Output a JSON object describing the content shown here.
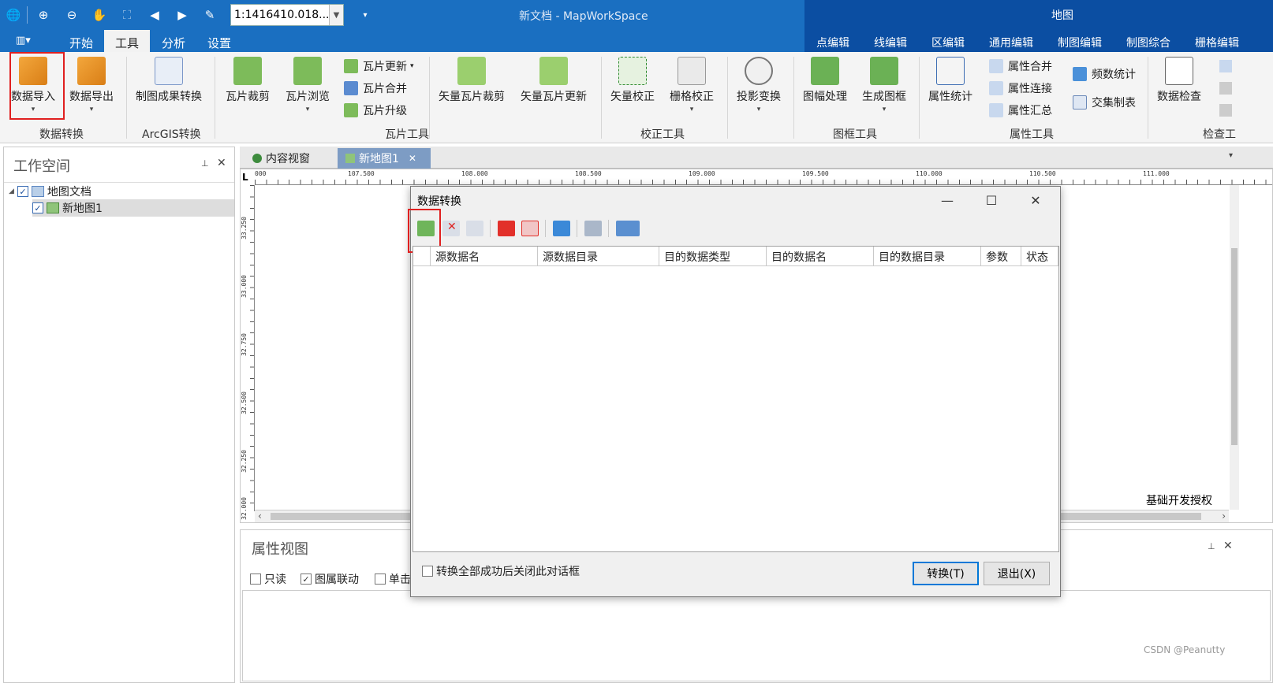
{
  "titlebar": {
    "scale_value": "1:1416410.018...",
    "doc_title": "新文档 - MapWorkSpace",
    "map_context_title": "地图"
  },
  "menu_tabs": [
    "开始",
    "工具",
    "分析",
    "设置"
  ],
  "menu_active": "工具",
  "context_tabs": [
    "点编辑",
    "线编辑",
    "区编辑",
    "通用编辑",
    "制图编辑",
    "制图综合",
    "栅格编辑"
  ],
  "ribbon": {
    "data_import": "数据导入",
    "data_export": "数据导出",
    "map_result_convert": "制图成果转换",
    "tile_clip": "瓦片裁剪",
    "tile_browse": "瓦片浏览",
    "tile_update": "瓦片更新",
    "tile_merge": "瓦片合并",
    "tile_upgrade": "瓦片升级",
    "vector_tile_clip": "矢量瓦片裁剪",
    "vector_tile_update": "矢量瓦片更新",
    "vector_correct": "矢量校正",
    "raster_correct": "栅格校正",
    "projection": "投影变换",
    "frame_process": "图幅处理",
    "gen_frame": "生成图框",
    "attr_stats": "属性统计",
    "attr_merge": "属性合并",
    "attr_join": "属性连接",
    "attr_summary": "属性汇总",
    "freq_stats": "频数统计",
    "cross_table": "交集制表",
    "data_check": "数据检查",
    "groups": {
      "data_convert": "数据转换",
      "arcgis_convert": "ArcGIS转换",
      "tile_tools": "瓦片工具",
      "correct_tools": "校正工具",
      "frame_tools": "图框工具",
      "attr_tools": "属性工具",
      "check_tools": "检查工"
    }
  },
  "workspace": {
    "title": "工作空间",
    "tree": [
      {
        "label": "地图文档",
        "checked": true
      },
      {
        "label": "新地图1",
        "checked": true
      }
    ]
  },
  "doc_tabs": [
    "内容视窗",
    "新地图1"
  ],
  "ruler": {
    "h_ticks": [
      "000",
      "107.500",
      "108.000",
      "108.500",
      "109.000",
      "109.500",
      "110.000",
      "110.500",
      "111.000"
    ],
    "v_ticks": [
      "33.250",
      "33.000",
      "32.750",
      "32.500",
      "32.250",
      "32.000"
    ]
  },
  "map_watermark": "基础开发授权",
  "properties": {
    "title": "属性视图",
    "checks": [
      {
        "label": "只读",
        "checked": false
      },
      {
        "label": "图属联动",
        "checked": true
      },
      {
        "label": "单击",
        "checked": false
      }
    ]
  },
  "dialog": {
    "title": "数据转换",
    "columns": [
      "源数据名",
      "源数据目录",
      "目的数据类型",
      "目的数据名",
      "目的数据目录",
      "参数",
      "状态"
    ],
    "close_checkbox_label": "转换全部成功后关闭此对话框",
    "convert_button": "转换(T)",
    "exit_button": "退出(X)"
  },
  "footer_credit": "CSDN @Peanutty",
  "colors": {
    "title_blue": "#1a6fc1",
    "context_blue": "#0b4ea2",
    "highlight_red": "#e02020"
  }
}
